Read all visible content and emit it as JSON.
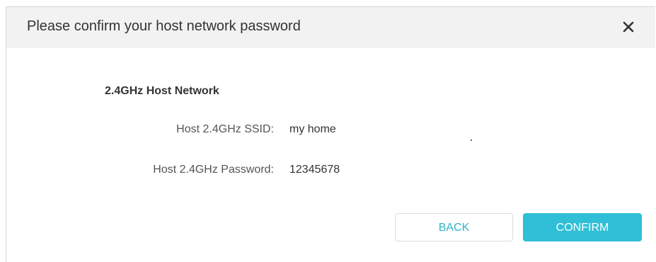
{
  "dialog": {
    "title": "Please confirm your host network password",
    "close_icon": "close-icon"
  },
  "section": {
    "title": "2.4GHz Host Network"
  },
  "fields": [
    {
      "label": "Host 2.4GHz SSID:",
      "value": "my home"
    },
    {
      "label": "Host 2.4GHz Password:",
      "value": "12345678"
    }
  ],
  "buttons": {
    "back_label": "BACK",
    "confirm_label": "CONFIRM"
  },
  "colors": {
    "header_bg": "#f2f2f2",
    "accent": "#2fbfd6",
    "back_text": "#2fb5c9"
  }
}
